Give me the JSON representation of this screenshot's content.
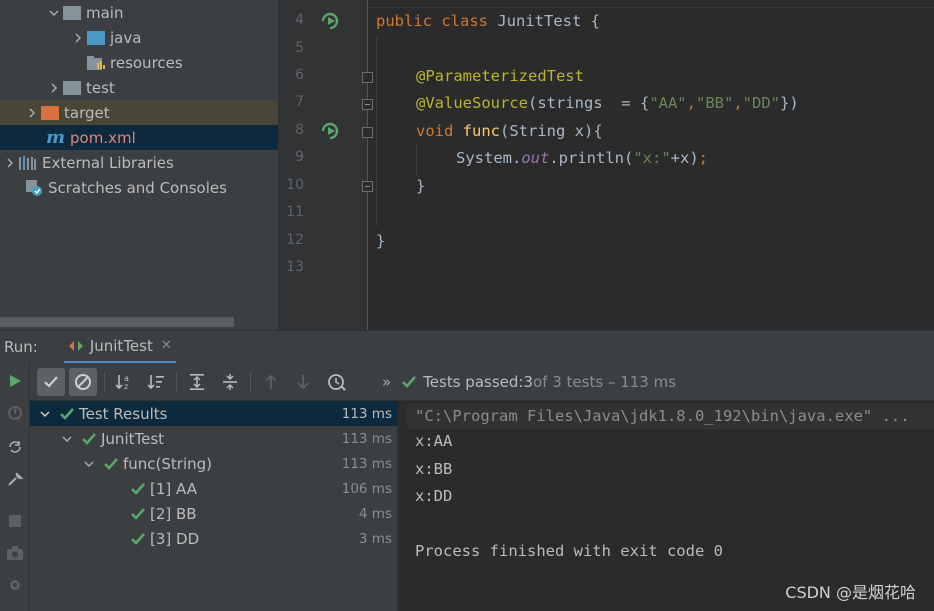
{
  "project_tree": {
    "items": [
      {
        "label": "main",
        "icon": "folder-icon",
        "expanded": true
      },
      {
        "label": "java",
        "icon": "source-folder-icon",
        "expanded": false
      },
      {
        "label": "resources",
        "icon": "resources-folder-icon"
      },
      {
        "label": "test",
        "icon": "folder-icon",
        "expanded": false
      },
      {
        "label": "target",
        "icon": "excluded-folder-icon",
        "expanded": false
      },
      {
        "label": "pom.xml",
        "icon": "maven-icon"
      },
      {
        "label": "External Libraries",
        "icon": "libraries-icon",
        "expanded": false
      },
      {
        "label": "Scratches and Consoles",
        "icon": "scratches-icon"
      }
    ]
  },
  "editor": {
    "line_numbers": [
      "4",
      "5",
      "6",
      "7",
      "8",
      "9",
      "10",
      "11",
      "12",
      "13"
    ],
    "code": {
      "l4_kw": "public class ",
      "l4_rest": "JunitTest {",
      "l6_ann": "@ParameterizedTest",
      "l7_ann": "@ValueSource",
      "l7_a": "(strings  = {",
      "l7_s1": "\"AA\"",
      "l7_c1": ",",
      "l7_s2": "\"BB\"",
      "l7_c2": ",",
      "l7_s3": "\"DD\"",
      "l7_end": "})",
      "l8_kw": "void ",
      "l8_fn": "func",
      "l8_rest": "(String x){",
      "l9_a": "System.",
      "l9_fld": "out",
      "l9_b": ".println(",
      "l9_str": "\"x:\"",
      "l9_c": "+x)",
      "l9_semi": ";",
      "l10": "}",
      "l12": "}"
    }
  },
  "run": {
    "title": "Run:",
    "tab_label": "JunitTest",
    "close_glyph": "✕",
    "status": {
      "chevron": "»",
      "passed_label": "Tests passed: ",
      "passed_count": "3",
      "detail": " of 3 tests – 113 ms"
    },
    "results": [
      {
        "label": "Test Results",
        "time": "113 ms",
        "expanded": true
      },
      {
        "label": "JunitTest",
        "time": "113 ms",
        "expanded": true
      },
      {
        "label": "func(String)",
        "time": "113 ms",
        "expanded": true
      },
      {
        "label": "[1] AA",
        "time": "106 ms"
      },
      {
        "label": "[2] BB",
        "time": "4 ms"
      },
      {
        "label": "[3] DD",
        "time": "3 ms"
      }
    ]
  },
  "console": {
    "lines": [
      "\"C:\\Program Files\\Java\\jdk1.8.0_192\\bin\\java.exe\" ...",
      "x:AA",
      "x:BB",
      "x:DD",
      "",
      "Process finished with exit code 0"
    ]
  },
  "watermark": "CSDN @是烟花哈",
  "colors": {
    "accent_green": "#59a869",
    "selection_blue": "#0d293e",
    "panel_bg": "#3c3f41",
    "editor_bg": "#2b2b2b"
  }
}
